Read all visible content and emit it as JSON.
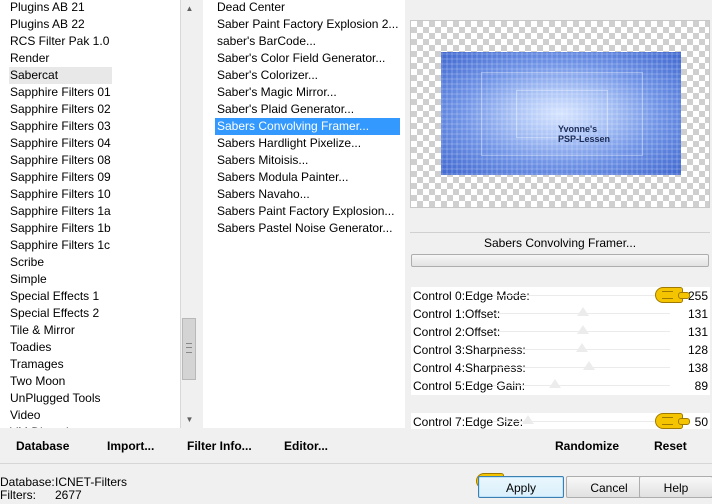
{
  "categories": {
    "items": [
      {
        "label": "Plugins AB 21"
      },
      {
        "label": "Plugins AB 22"
      },
      {
        "label": "RCS Filter Pak 1.0"
      },
      {
        "label": "Render"
      },
      {
        "label": "Sabercat",
        "selected": true
      },
      {
        "label": "Sapphire Filters 01"
      },
      {
        "label": "Sapphire Filters 02"
      },
      {
        "label": "Sapphire Filters 03"
      },
      {
        "label": "Sapphire Filters 04"
      },
      {
        "label": "Sapphire Filters 08"
      },
      {
        "label": "Sapphire Filters 09"
      },
      {
        "label": "Sapphire Filters 10"
      },
      {
        "label": "Sapphire Filters 1a"
      },
      {
        "label": "Sapphire Filters 1b"
      },
      {
        "label": "Sapphire Filters 1c"
      },
      {
        "label": "Scribe"
      },
      {
        "label": "Simple"
      },
      {
        "label": "Special Effects 1"
      },
      {
        "label": "Special Effects 2"
      },
      {
        "label": "Tile & Mirror"
      },
      {
        "label": "Toadies"
      },
      {
        "label": "Tramages"
      },
      {
        "label": "Two Moon"
      },
      {
        "label": "UnPlugged Tools"
      },
      {
        "label": "Video"
      },
      {
        "label": "VM Distortion",
        "partial": true
      }
    ],
    "scrollbar": {
      "up_icon": "arrow-up-icon",
      "down_icon": "arrow-down-icon",
      "thumb_icon": "grip-icon"
    }
  },
  "filters": {
    "items": [
      {
        "label": "Dead Center"
      },
      {
        "label": "Saber Paint Factory Explosion 2..."
      },
      {
        "label": "saber's BarCode..."
      },
      {
        "label": "Saber's Color Field Generator..."
      },
      {
        "label": "Saber's Colorizer..."
      },
      {
        "label": "Saber's Magic Mirror..."
      },
      {
        "label": "Saber's Plaid Generator..."
      },
      {
        "label": "Sabers Convolving Framer...",
        "selected": true
      },
      {
        "label": "Sabers Hardlight Pixelize..."
      },
      {
        "label": "Sabers Mitoisis..."
      },
      {
        "label": "Sabers Modula Painter..."
      },
      {
        "label": "Sabers Navaho..."
      },
      {
        "label": "Sabers Paint Factory Explosion..."
      },
      {
        "label": "Sabers Pastel Noise Generator..."
      }
    ]
  },
  "preview": {
    "watermark_line1": "Yvonne's",
    "watermark_line2": "PSP-Lessen"
  },
  "filter_title": "Sabers Convolving Framer...",
  "controls": [
    {
      "label": "Control 0:Edge Mode:",
      "value": "255",
      "level": 1.0,
      "pointer": "hand-pointer-icon"
    },
    {
      "label": "Control 1:Offset:",
      "value": "131",
      "level": 0.51
    },
    {
      "label": "Control 2:Offset:",
      "value": "131",
      "level": 0.51
    },
    {
      "label": "Control 3:Sharpness:",
      "value": "128",
      "level": 0.5
    },
    {
      "label": "Control 4:Sharpness:",
      "value": "138",
      "level": 0.54
    },
    {
      "label": "Control 5:Edge Gain:",
      "value": "89",
      "level": 0.35
    },
    {
      "label": "",
      "value": "",
      "empty": true
    },
    {
      "label": "Control 7:Edge Size:",
      "value": "50",
      "level": 0.2,
      "pointer": "hand-pointer-icon"
    }
  ],
  "actions": {
    "database": "Database",
    "import": "Import...",
    "filter_info": "Filter Info...",
    "editor": "Editor...",
    "randomize": "Randomize",
    "reset": "Reset"
  },
  "status": {
    "database_label": "Database:",
    "database_value": "ICNET-Filters",
    "filters_label": "Filters:",
    "filters_value": "2677"
  },
  "buttons": {
    "apply": "Apply",
    "cancel": "Cancel",
    "help": "Help"
  }
}
